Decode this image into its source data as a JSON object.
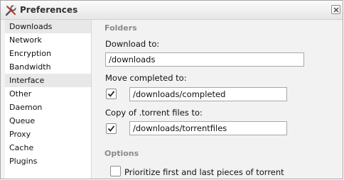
{
  "window": {
    "title": "Preferences",
    "close_icon": "close-icon",
    "app_icon": "tools-icon"
  },
  "sidebar": {
    "items": [
      {
        "label": "Downloads",
        "selected": true
      },
      {
        "label": "Network",
        "selected": false
      },
      {
        "label": "Encryption",
        "selected": false
      },
      {
        "label": "Bandwidth",
        "selected": false
      },
      {
        "label": "Interface",
        "selected": true
      },
      {
        "label": "Other",
        "selected": false
      },
      {
        "label": "Daemon",
        "selected": false
      },
      {
        "label": "Queue",
        "selected": false
      },
      {
        "label": "Proxy",
        "selected": false
      },
      {
        "label": "Cache",
        "selected": false
      },
      {
        "label": "Plugins",
        "selected": false
      }
    ]
  },
  "folders": {
    "title": "Folders",
    "download_to": {
      "label": "Download to:",
      "value": "/downloads"
    },
    "move_completed": {
      "label": "Move completed to:",
      "checked": true,
      "value": "/downloads/completed"
    },
    "copy_torrent": {
      "label": "Copy of .torrent files to:",
      "checked": true,
      "value": "/downloads/torrentfiles"
    }
  },
  "options": {
    "title": "Options",
    "prioritize": {
      "label": "Prioritize first and last pieces of torrent",
      "checked": false
    }
  }
}
